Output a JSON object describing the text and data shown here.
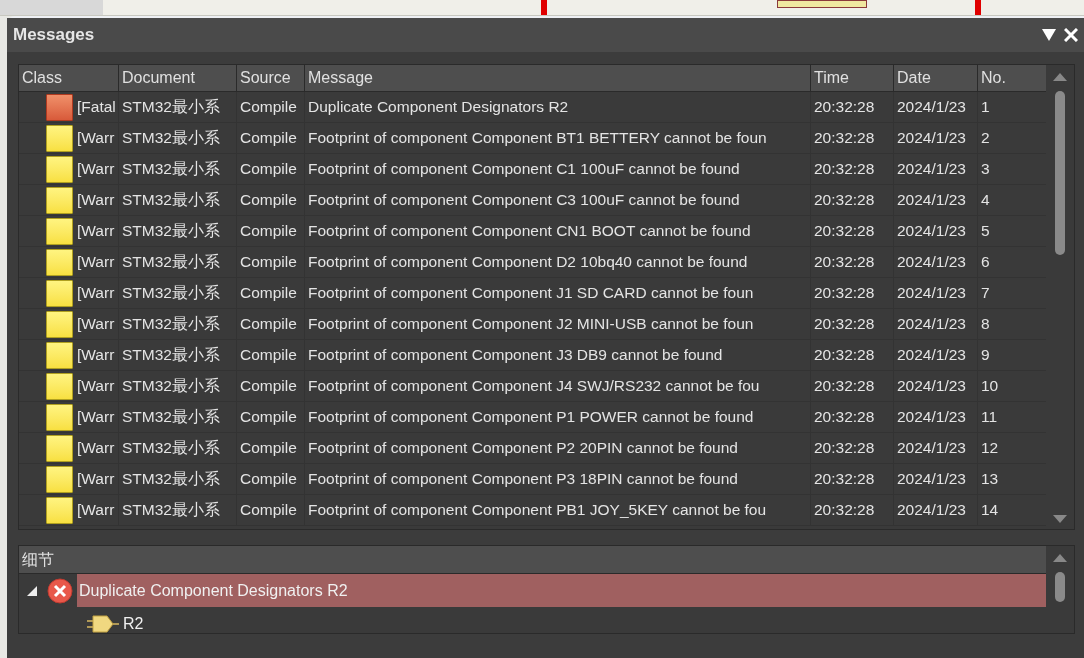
{
  "panel": {
    "title": "Messages"
  },
  "table": {
    "columns": [
      "Class",
      "Document",
      "Source",
      "Message",
      "Time",
      "Date",
      "No."
    ],
    "rows": [
      {
        "kind": "fatal",
        "class": "[Fatal",
        "document": "STM32最小系",
        "source": "Compile",
        "message": "Duplicate Component Designators R2",
        "time": "20:32:28",
        "date": "2024/1/23",
        "no": "1"
      },
      {
        "kind": "warning",
        "class": "[Warr",
        "document": "STM32最小系",
        "source": "Compile",
        "message": "Footprint of component Component BT1 BETTERY cannot be foun",
        "time": "20:32:28",
        "date": "2024/1/23",
        "no": "2"
      },
      {
        "kind": "warning",
        "class": "[Warr",
        "document": "STM32最小系",
        "source": "Compile",
        "message": "Footprint of component Component C1 100uF cannot be found",
        "time": "20:32:28",
        "date": "2024/1/23",
        "no": "3"
      },
      {
        "kind": "warning",
        "class": "[Warr",
        "document": "STM32最小系",
        "source": "Compile",
        "message": "Footprint of component Component C3 100uF cannot be found",
        "time": "20:32:28",
        "date": "2024/1/23",
        "no": "4"
      },
      {
        "kind": "warning",
        "class": "[Warr",
        "document": "STM32最小系",
        "source": "Compile",
        "message": "Footprint of component Component CN1 BOOT cannot be found",
        "time": "20:32:28",
        "date": "2024/1/23",
        "no": "5"
      },
      {
        "kind": "warning",
        "class": "[Warr",
        "document": "STM32最小系",
        "source": "Compile",
        "message": "Footprint of component Component D2 10bq40 cannot be found",
        "time": "20:32:28",
        "date": "2024/1/23",
        "no": "6"
      },
      {
        "kind": "warning",
        "class": "[Warr",
        "document": "STM32最小系",
        "source": "Compile",
        "message": "Footprint of component Component J1 SD CARD cannot be foun",
        "time": "20:32:28",
        "date": "2024/1/23",
        "no": "7"
      },
      {
        "kind": "warning",
        "class": "[Warr",
        "document": "STM32最小系",
        "source": "Compile",
        "message": "Footprint of component Component J2 MINI-USB cannot be foun",
        "time": "20:32:28",
        "date": "2024/1/23",
        "no": "8"
      },
      {
        "kind": "warning",
        "class": "[Warr",
        "document": "STM32最小系",
        "source": "Compile",
        "message": "Footprint of component Component J3 DB9 cannot be found",
        "time": "20:32:28",
        "date": "2024/1/23",
        "no": "9"
      },
      {
        "kind": "warning",
        "class": "[Warr",
        "document": "STM32最小系",
        "source": "Compile",
        "message": "Footprint of component Component J4 SWJ/RS232 cannot be fou",
        "time": "20:32:28",
        "date": "2024/1/23",
        "no": "10"
      },
      {
        "kind": "warning",
        "class": "[Warr",
        "document": "STM32最小系",
        "source": "Compile",
        "message": "Footprint of component Component P1 POWER cannot be found",
        "time": "20:32:28",
        "date": "2024/1/23",
        "no": "11"
      },
      {
        "kind": "warning",
        "class": "[Warr",
        "document": "STM32最小系",
        "source": "Compile",
        "message": "Footprint of component Component P2 20PIN cannot be found",
        "time": "20:32:28",
        "date": "2024/1/23",
        "no": "12"
      },
      {
        "kind": "warning",
        "class": "[Warr",
        "document": "STM32最小系",
        "source": "Compile",
        "message": "Footprint of component Component P3 18PIN cannot be found",
        "time": "20:32:28",
        "date": "2024/1/23",
        "no": "13"
      },
      {
        "kind": "warning",
        "class": "[Warr",
        "document": "STM32最小系",
        "source": "Compile",
        "message": "Footprint of component Component PB1 JOY_5KEY cannot be fou",
        "time": "20:32:28",
        "date": "2024/1/23",
        "no": "14"
      }
    ]
  },
  "details": {
    "title": "细节",
    "items": [
      {
        "kind": "error",
        "label": "Duplicate Component Designators R2",
        "expanded": true,
        "selected": true,
        "children": [
          {
            "kind": "component",
            "label": "R2",
            "selected": false
          }
        ]
      }
    ]
  }
}
